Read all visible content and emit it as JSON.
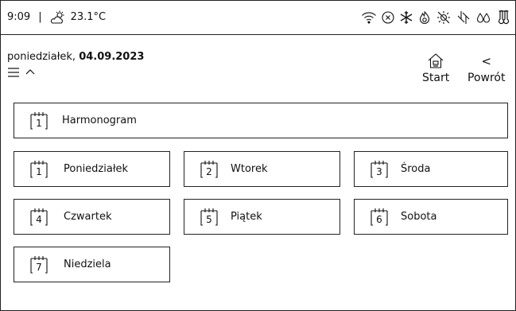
{
  "status": {
    "time": "9:09",
    "separator": "|",
    "temperature": "23.1°C",
    "icons": [
      "weather-partly-sunny-icon",
      "wifi-icon",
      "alarm-x-icon",
      "snowflake-icon",
      "flame-icon",
      "sun-off-icon",
      "heat-pump-icon",
      "water-drops-icon",
      "thermometer-icon"
    ]
  },
  "header": {
    "day_name": "poniedziałek,",
    "date": "04.09.2023"
  },
  "nav": {
    "start_label": "Start",
    "back_label": "Powrót",
    "back_glyph": "<"
  },
  "schedule": {
    "label": "Harmonogram",
    "number": "1"
  },
  "days": [
    {
      "number": "1",
      "label": "Poniedziałek"
    },
    {
      "number": "2",
      "label": "Wtorek"
    },
    {
      "number": "3",
      "label": "Środa"
    },
    {
      "number": "4",
      "label": "Czwartek"
    },
    {
      "number": "5",
      "label": "Piątek"
    },
    {
      "number": "6",
      "label": "Sobota"
    },
    {
      "number": "7",
      "label": "Niedziela"
    }
  ]
}
